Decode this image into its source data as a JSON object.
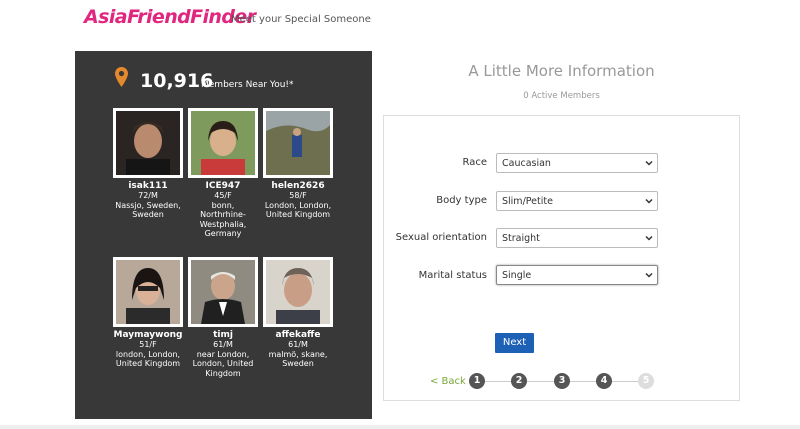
{
  "header": {
    "logo": "AsiaFriendFinder",
    "tagline": "Meet your Special Someone"
  },
  "members_panel": {
    "count": "10,916",
    "count_label": "Members Near You!*",
    "members": [
      {
        "name": "isak111",
        "info": "72/M",
        "location": "Nassjo, Sweden, Sweden"
      },
      {
        "name": "ICE947",
        "info": "45/F",
        "location": "bonn, Northrhine-Westphalia, Germany"
      },
      {
        "name": "helen2626",
        "info": "58/F",
        "location": "London, London, United Kingdom"
      },
      {
        "name": "Maymaywong",
        "info": "51/F",
        "location": "london, London, United Kingdom"
      },
      {
        "name": "timj",
        "info": "61/M",
        "location": "near London, London, United Kingdom"
      },
      {
        "name": "affekaffe",
        "info": "61/M",
        "location": "malmö, skane, Sweden"
      }
    ]
  },
  "form": {
    "title": "A Little More Information",
    "active_members": "0 Active Members",
    "fields": [
      {
        "label": "Race",
        "value": "Caucasian"
      },
      {
        "label": "Body type",
        "value": "Slim/Petite"
      },
      {
        "label": "Sexual orientation",
        "value": "Straight"
      },
      {
        "label": "Marital status",
        "value": "Single"
      }
    ],
    "next_label": "Next",
    "back_label": "< Back",
    "steps": [
      "1",
      "2",
      "3",
      "4",
      "5"
    ]
  }
}
